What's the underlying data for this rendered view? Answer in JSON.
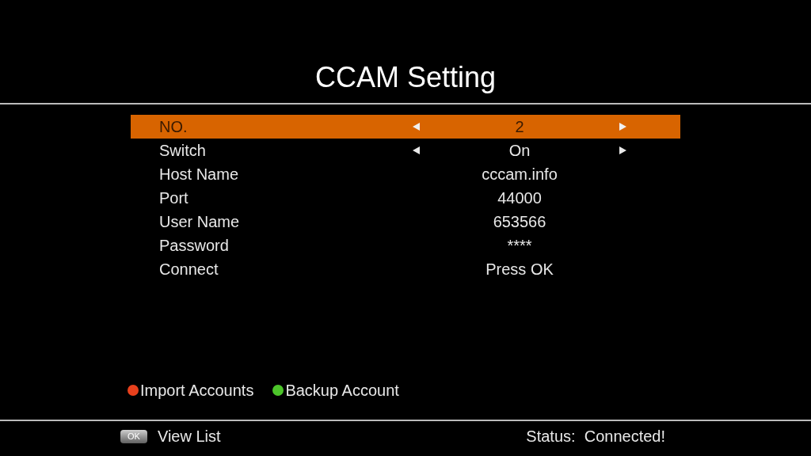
{
  "title": "CCAM Setting",
  "rows": [
    {
      "label": "NO.",
      "value": "2",
      "kind": "selector",
      "selected": true
    },
    {
      "label": "Switch",
      "value": "On",
      "kind": "selector",
      "selected": false
    },
    {
      "label": "Host Name",
      "value": "cccam.info",
      "kind": "text",
      "selected": false
    },
    {
      "label": "Port",
      "value": "44000",
      "kind": "text",
      "selected": false
    },
    {
      "label": "User Name",
      "value": "653566",
      "kind": "text",
      "selected": false
    },
    {
      "label": "Password",
      "value": "****",
      "kind": "text",
      "selected": false
    },
    {
      "label": "Connect",
      "value": "Press OK",
      "kind": "text",
      "selected": false
    }
  ],
  "color_keys": [
    {
      "label": "Import Accounts",
      "color": "#e8401c"
    },
    {
      "label": "Backup Account",
      "color": "#4cc42a"
    }
  ],
  "footer": {
    "key": "OK",
    "action": "View List",
    "status": "Status:  Connected!"
  }
}
